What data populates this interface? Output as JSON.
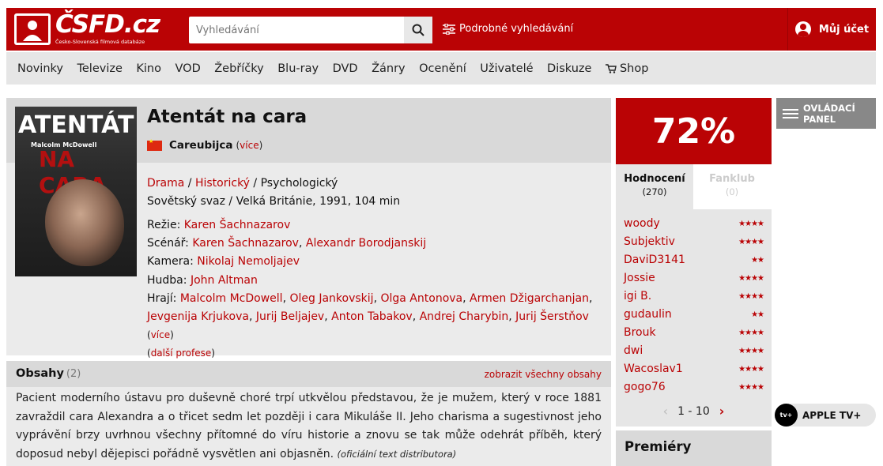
{
  "header": {
    "logo_text": "ČSFD.cz",
    "logo_sub": "Česko-Slovenská filmová databáze",
    "search_placeholder": "Vyhledávání",
    "advanced_search": "Podrobné vyhledávání",
    "account": "Můj účet"
  },
  "nav": {
    "items": [
      "Novinky",
      "Televize",
      "Kino",
      "VOD",
      "Žebříčky",
      "Blu-ray",
      "DVD",
      "Žánry",
      "Ocenění",
      "Uživatelé",
      "Diskuze"
    ],
    "shop": "Shop"
  },
  "film": {
    "title": "Atentát na cara",
    "alt_title": "Careubijca",
    "alt_more": "více",
    "genres": [
      "Drama",
      "Historický",
      "Psychologický"
    ],
    "origin": "Sovětský svaz / Velká Británie, 1991, 104 min",
    "director_label": "Režie:",
    "director": "Karen Šachnazarov",
    "writer_label": "Scénář:",
    "writers": [
      "Karen Šachnazarov",
      "Alexandr Borodjanskij"
    ],
    "camera_label": "Kamera:",
    "camera": "Nikolaj Nemoljajev",
    "music_label": "Hudba:",
    "music": "John Altman",
    "cast_label": "Hrají:",
    "cast": [
      "Malcolm McDowell",
      "Oleg Jankovskij",
      "Olga Antonova",
      "Armen Džigarchanjan",
      "Jevgenija Krjukova",
      "Jurij Beljajev",
      "Anton Tabakov",
      "Andrej Charybin",
      "Jurij Šerstňov"
    ],
    "cast_more": "více",
    "more_professions": "další profese",
    "poster": {
      "title_top": "ATENTÁT",
      "actor": "Malcolm McDowell",
      "title_bottom": "NA CARA"
    }
  },
  "plot": {
    "title": "Obsahy",
    "count": "(2)",
    "show_all": "zobrazit všechny obsahy",
    "text": "Pacient moderního ústavu pro duševně choré trpí utkvělou představou, že je mužem, který v roce 1881 zavraždil cara Alexandra a o třicet sedm let později i cara Mikuláše II. Jeho charisma a sugestivnost jeho vyprávění brzy uvrhnou všechny přítomné do víru historie a znovu se tak může odehrát příběh, který doposud nebyl dějepisci pořádně vysvětlen ani objasněn.",
    "source": "(oficiální text distributora)"
  },
  "rating": {
    "percent": "72%",
    "tab_ratings": "Hodnocení",
    "tab_ratings_count": "(270)",
    "tab_fanclub": "Fanklub",
    "tab_fanclub_count": "(0)",
    "users": [
      {
        "name": "woody",
        "stars": "★★★★"
      },
      {
        "name": "Subjektiv",
        "stars": "★★★★"
      },
      {
        "name": "DaviD3141",
        "stars": "★★"
      },
      {
        "name": "Jossie",
        "stars": "★★★★"
      },
      {
        "name": "igi B.",
        "stars": "★★★★"
      },
      {
        "name": "gudaulin",
        "stars": "★★"
      },
      {
        "name": "Brouk",
        "stars": "★★★★"
      },
      {
        "name": "dwi",
        "stars": "★★★★"
      },
      {
        "name": "Wacoslav1",
        "stars": "★★★★"
      },
      {
        "name": "gogo76",
        "stars": "★★★★"
      }
    ],
    "pager": "1 - 10"
  },
  "sidebar": {
    "control_panel": "OVLÁDACÍ PANEL",
    "apple_tv": "APPLE TV+",
    "premiery": "Premiéry"
  },
  "colors": {
    "brand_red": "#ba0305",
    "panel_gray": "#ebebeb"
  }
}
